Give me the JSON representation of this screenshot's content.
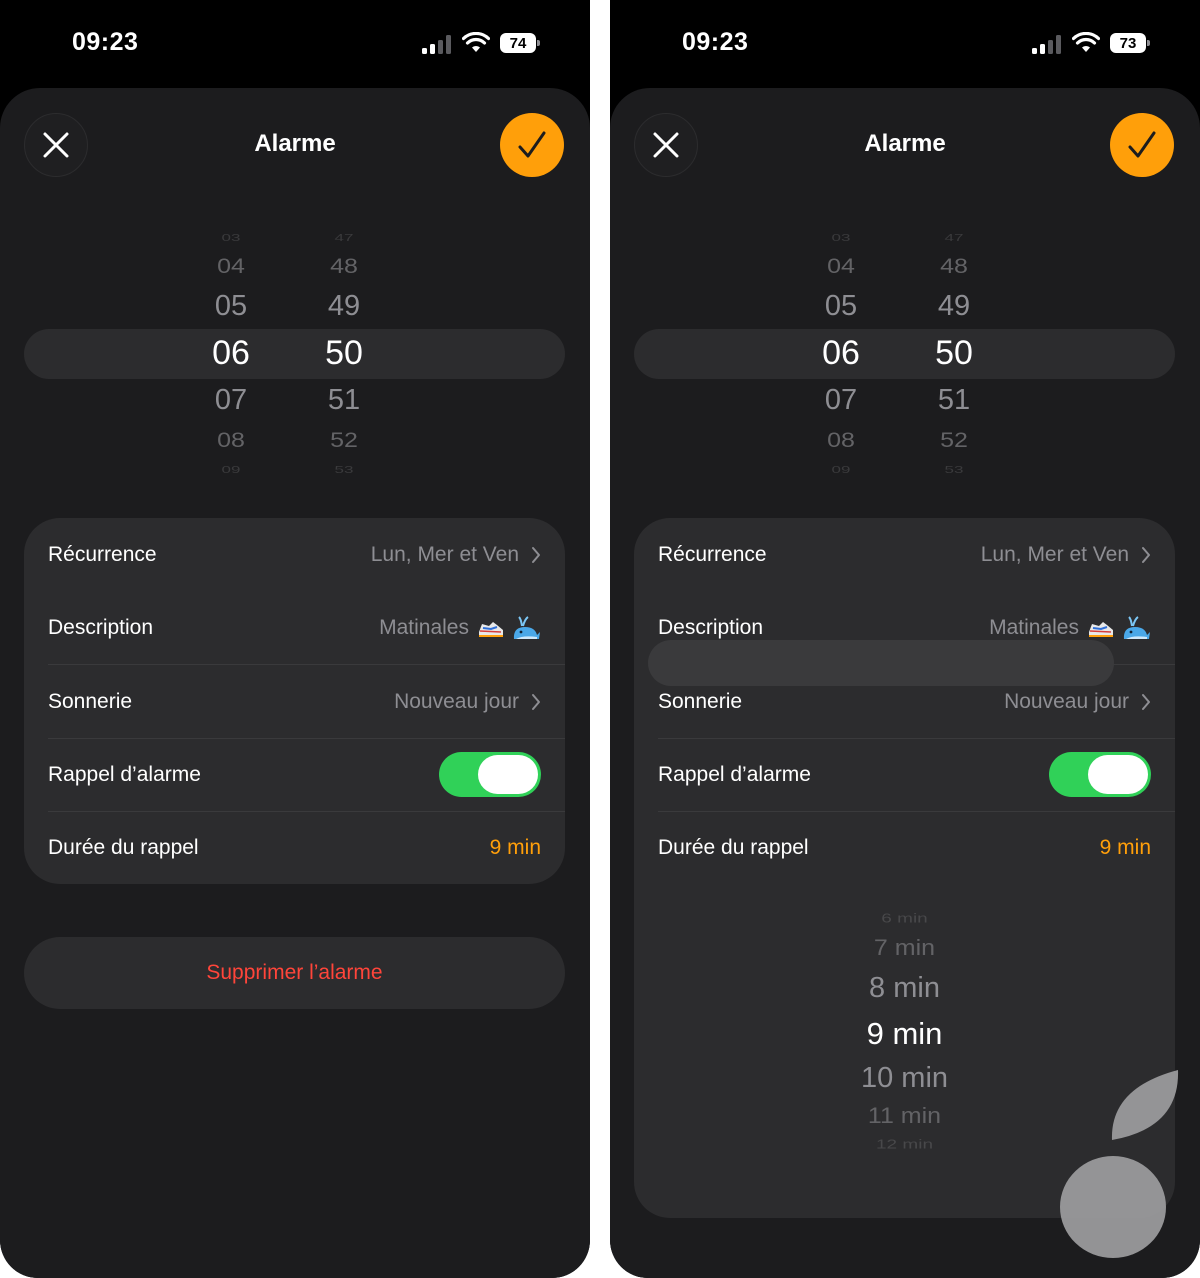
{
  "left": {
    "status": {
      "time": "09:23",
      "battery": "74"
    },
    "header": {
      "title": "Alarme",
      "close_icon": "xmark-icon",
      "confirm_icon": "checkmark-icon"
    },
    "time_picker": {
      "hours": [
        "03",
        "04",
        "05",
        "06",
        "07",
        "08",
        "09"
      ],
      "minutes": [
        "47",
        "48",
        "49",
        "50",
        "51",
        "52",
        "53"
      ],
      "selected_hour": "06",
      "selected_minute": "50"
    },
    "settings": {
      "recurrence_label": "Récurrence",
      "recurrence_value": "Lun, Mer et Ven",
      "description_label": "Description",
      "description_value": "Matinales",
      "ringtone_label": "Sonnerie",
      "ringtone_value": "Nouveau jour",
      "snooze_label": "Rappel d’alarme",
      "snooze_enabled": true,
      "snooze_duration_label": "Durée du rappel",
      "snooze_duration_value": "9 min"
    },
    "delete_label": "Supprimer l’alarme"
  },
  "right": {
    "status": {
      "time": "09:23",
      "battery": "73"
    },
    "header": {
      "title": "Alarme",
      "close_icon": "xmark-icon",
      "confirm_icon": "checkmark-icon"
    },
    "time_picker": {
      "hours": [
        "03",
        "04",
        "05",
        "06",
        "07",
        "08",
        "09"
      ],
      "minutes": [
        "47",
        "48",
        "49",
        "50",
        "51",
        "52",
        "53"
      ],
      "selected_hour": "06",
      "selected_minute": "50"
    },
    "settings": {
      "recurrence_label": "Récurrence",
      "recurrence_value": "Lun, Mer et Ven",
      "description_label": "Description",
      "description_value": "Matinales",
      "ringtone_label": "Sonnerie",
      "ringtone_value": "Nouveau jour",
      "snooze_label": "Rappel d’alarme",
      "snooze_enabled": true,
      "snooze_duration_label": "Durée du rappel",
      "snooze_duration_value": "9 min"
    },
    "snooze_picker": {
      "options": [
        "6 min",
        "7 min",
        "8 min",
        "9 min",
        "10 min",
        "11 min",
        "12 min"
      ],
      "selected": "9 min"
    }
  },
  "colors": {
    "accent": "#ff9f0a",
    "toggle_on": "#30d158",
    "destructive": "#ff453a",
    "secondary_text": "#8e8e93",
    "sheet_background": "#1c1c1e",
    "card_background": "#2c2c2e"
  },
  "icons": {
    "signal": "cellular-signal-icon",
    "wifi": "wifi-icon",
    "battery": "battery-icon",
    "chevron": "chevron-right-icon",
    "description_emojis": [
      "sneaker-emoji-icon",
      "whale-emoji-icon"
    ],
    "watermark": "leaf-watermark-icon"
  }
}
